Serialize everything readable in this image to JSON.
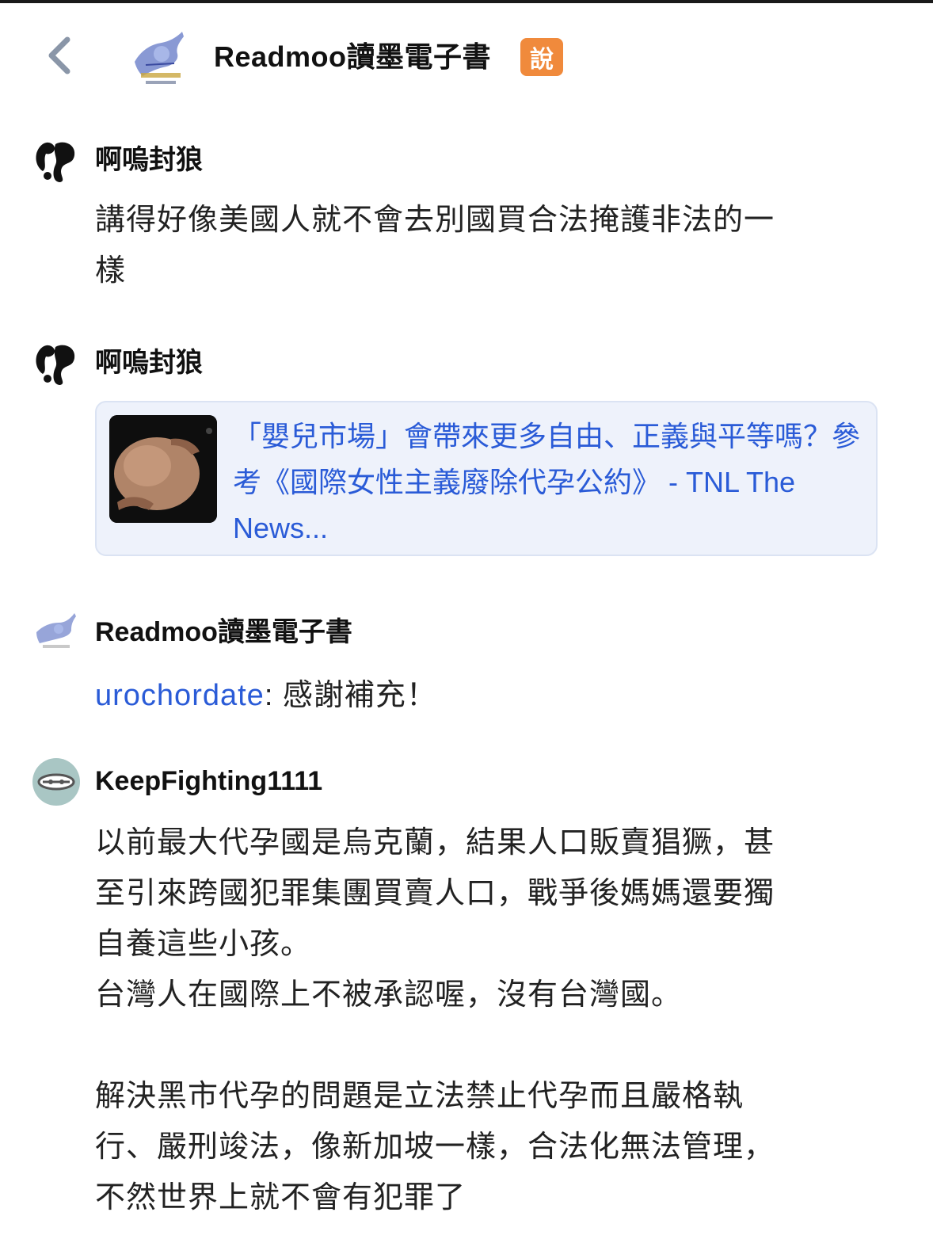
{
  "header": {
    "title": "Readmoo讀墨電子書",
    "badge": "說"
  },
  "comments": [
    {
      "user": "啊嗚封狼",
      "text": "講得好像美國人就不會去別國買合法掩護非法的一\n樣"
    },
    {
      "user": "啊嗚封狼",
      "link_card": {
        "title": "「嬰兒市場」會帶來更多自由、正義與平等嗎？參考《國際女性主義廢除代孕公約》 - TNL The News..."
      }
    },
    {
      "user": "Readmoo讀墨電子書",
      "mention": "urochordate",
      "text": ": 感謝補充！"
    },
    {
      "user": "KeepFighting1111",
      "text": "以前最大代孕國是烏克蘭，結果人口販賣猖獗，甚\n至引來跨國犯罪集團買賣人口，戰爭後媽媽還要獨\n自養這些小孩。\n台灣人在國際上不被承認喔，沒有台灣國。\n\n解決黑市代孕的問題是立法禁止代孕而且嚴格執\n行、嚴刑竣法，像新加坡一樣，合法化無法管理，\n不然世界上就不會有犯罪了"
    }
  ],
  "colors": {
    "link": "#2a5bd7",
    "badge": "#f08a3c",
    "card_bg": "#eef2fb"
  }
}
